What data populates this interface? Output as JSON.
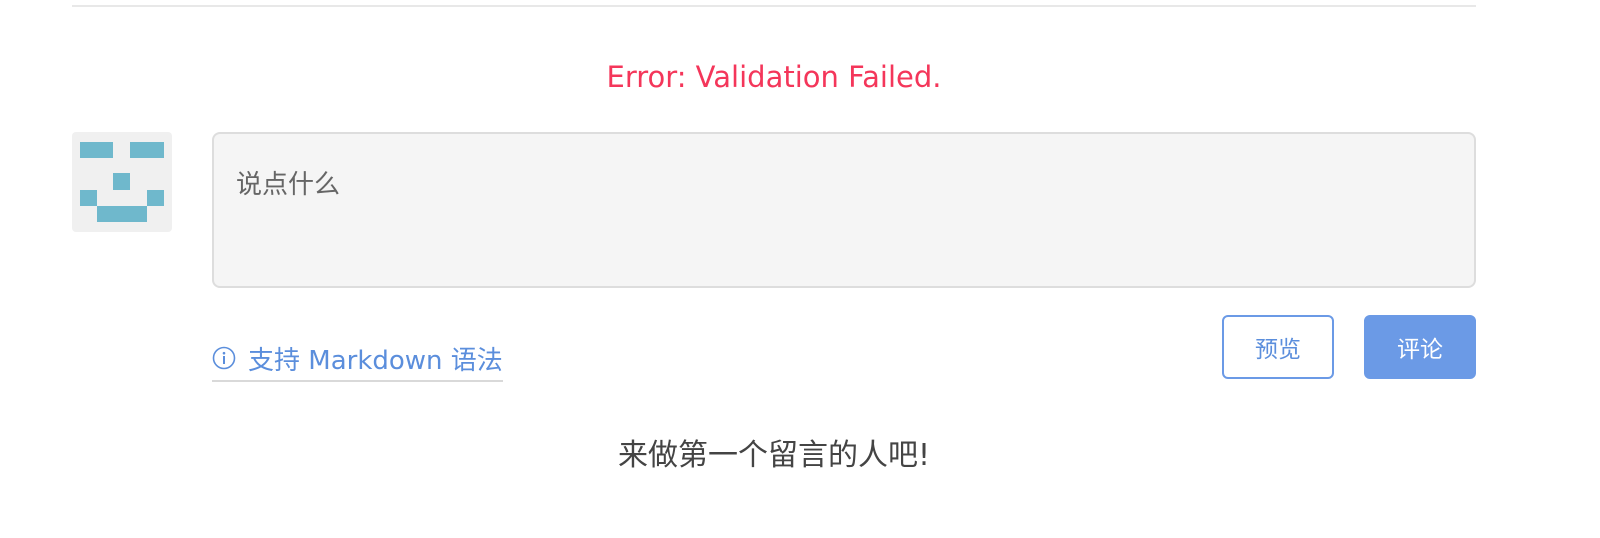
{
  "error": {
    "message": "Error: Validation Failed."
  },
  "comment_form": {
    "placeholder": "说点什么",
    "markdown_hint": "支持 Markdown 语法",
    "preview_label": "预览",
    "submit_label": "评论"
  },
  "comments": {
    "empty_message": "来做第一个留言的人吧!"
  },
  "colors": {
    "error": "#f4365a",
    "accent": "#6b9ae6",
    "avatar_pixels": "#6fb8cc"
  },
  "icons": {
    "avatar": "pixel-face-avatar",
    "markdown_hint": "info-circle-icon"
  }
}
